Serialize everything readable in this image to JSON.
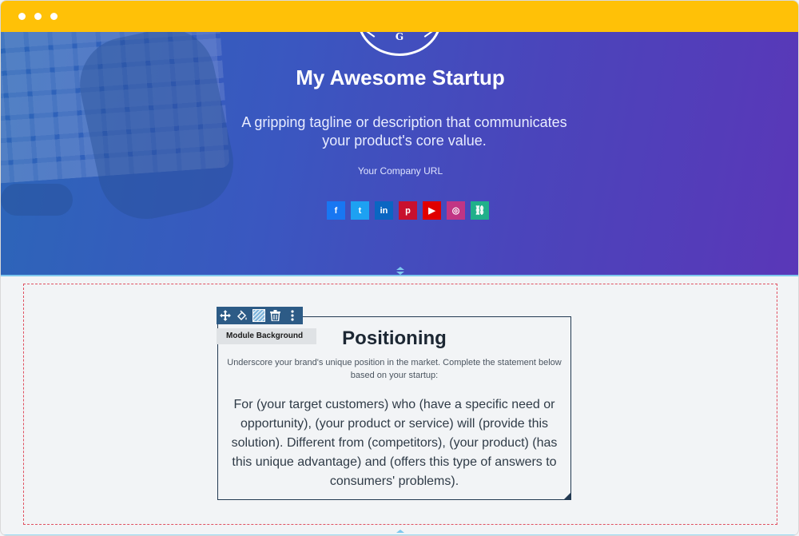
{
  "window": {
    "controls": [
      "dot",
      "dot",
      "dot"
    ]
  },
  "hero": {
    "logo_letter": "G",
    "title": "My Awesome Startup",
    "tagline": "A gripping tagline or description that communicates your product's core value.",
    "url_text": "Your Company URL",
    "gradient": {
      "from": "#2c66b8",
      "to": "#5a37b8"
    },
    "socials": [
      {
        "name": "facebook-icon",
        "glyph": "f",
        "color": "#1877f2"
      },
      {
        "name": "twitter-icon",
        "glyph": "t",
        "color": "#1da1f2"
      },
      {
        "name": "linkedin-icon",
        "glyph": "in",
        "color": "#0a66c2"
      },
      {
        "name": "pinterest-icon",
        "glyph": "p",
        "color": "#c8102e"
      },
      {
        "name": "youtube-icon",
        "glyph": "▶",
        "color": "#e00000"
      },
      {
        "name": "instagram-icon",
        "glyph": "◎",
        "color": "#c13584"
      },
      {
        "name": "link-icon",
        "glyph": "⛓",
        "color": "#20b08a"
      }
    ]
  },
  "editor": {
    "toolbar": [
      "move-icon",
      "paint-bucket-icon",
      "background-pattern-icon",
      "trash-icon",
      "more-options-icon"
    ],
    "module_tag": "Module Background",
    "accent": "#2d5b86",
    "dash_color": "#e05060"
  },
  "positioning": {
    "title": "Positioning",
    "subtitle": "Underscore your brand's unique position in the market. Complete the statement below based on your startup:",
    "body": "For (your target customers) who (have a specific need or opportunity), (your product or service) will (provide this solution). Different from (competitors), (your product) (has this unique advantage) and (offers this type of answers to consumers' problems)."
  }
}
